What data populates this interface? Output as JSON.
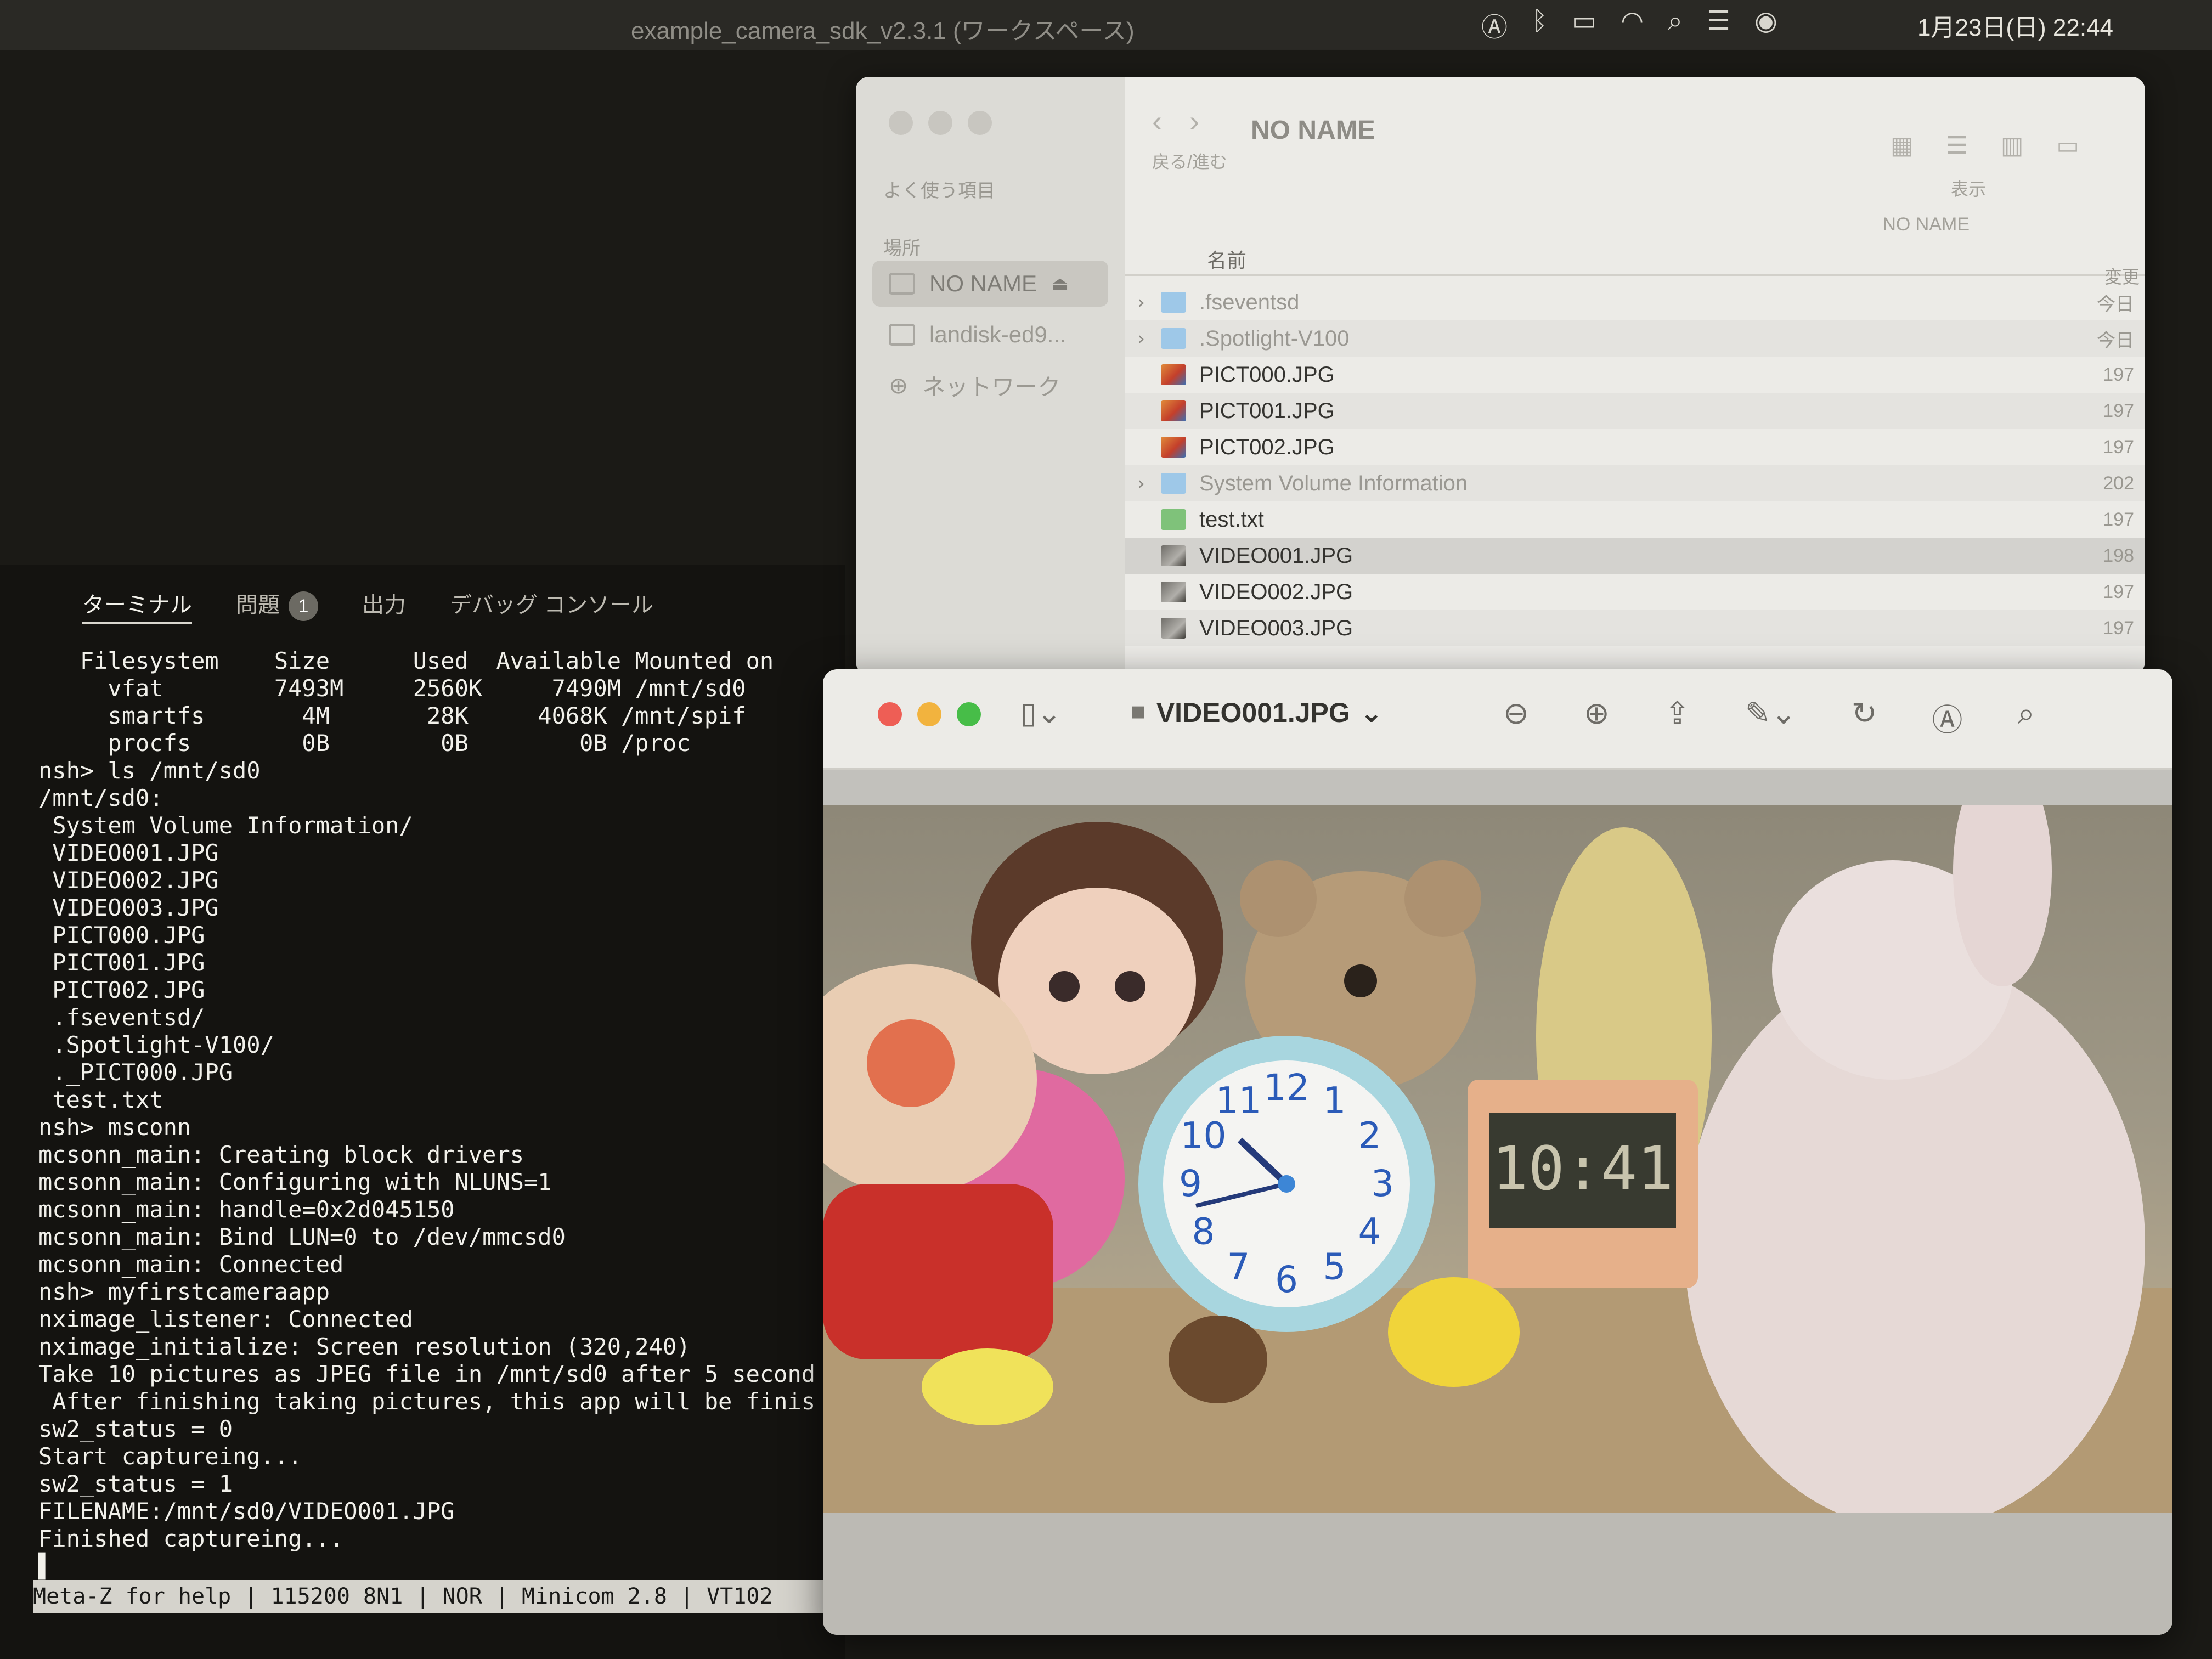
{
  "menubar": {
    "window_title": "example_camera_sdk_v2.3.1 (ワークスペース)",
    "clock": "1月23日(日) 22:44",
    "icons": [
      "input-method-icon",
      "bluetooth-icon",
      "battery-icon",
      "wifi-icon",
      "search-icon",
      "control-center-icon",
      "siri-icon"
    ]
  },
  "terminal": {
    "tabs": [
      {
        "label": "ターミナル",
        "active": true
      },
      {
        "label": "問題",
        "badge": "1"
      },
      {
        "label": "出力"
      },
      {
        "label": "デバッグ コンソール"
      }
    ],
    "lines": [
      "   Filesystem    Size      Used  Available Mounted on",
      "     vfat        7493M     2560K     7490M /mnt/sd0",
      "     smartfs       4M       28K     4068K /mnt/spif",
      "     procfs        0B        0B        0B /proc",
      "nsh> ls /mnt/sd0",
      "/mnt/sd0:",
      " System Volume Information/",
      " VIDEO001.JPG",
      " VIDEO002.JPG",
      " VIDEO003.JPG",
      " PICT000.JPG",
      " PICT001.JPG",
      " PICT002.JPG",
      " .fseventsd/",
      " .Spotlight-V100/",
      " ._PICT000.JPG",
      " test.txt",
      "nsh> msconn",
      "mcsonn_main: Creating block drivers",
      "mcsonn_main: Configuring with NLUNS=1",
      "mcsonn_main: handle=0x2d045150",
      "mcsonn_main: Bind LUN=0 to /dev/mmcsd0",
      "mcsonn_main: Connected",
      "nsh> myfirstcameraapp",
      "nximage_listener: Connected",
      "nximage_initialize: Screen resolution (320,240)",
      "Take 10 pictures as JPEG file in /mnt/sd0 after 5 second",
      " After finishing taking pictures, this app will be finis",
      "sw2_status = 0",
      "Start captureing...",
      "sw2_status = 1",
      "FILENAME:/mnt/sd0/VIDEO001.JPG",
      "Finished captureing...",
      "▌"
    ],
    "status_bar": "Meta-Z for help | 115200 8N1 | NOR | Minicom 2.8 | VT102"
  },
  "finder": {
    "title": "NO NAME",
    "nav_label": "戻る/進む",
    "view_label": "表示",
    "path_label": "NO NAME",
    "favorites_label": "よく使う項目",
    "locations_label": "場所",
    "sidebar_items": [
      {
        "label": "NO NAME",
        "selected": true
      },
      {
        "label": "landisk-ed9..."
      },
      {
        "label": "ネットワーク"
      }
    ],
    "column_name": "名前",
    "column_changed": "変更",
    "files": [
      {
        "name": ".fseventsd",
        "type": "folder",
        "expandable": true,
        "dim": true,
        "date": "今日"
      },
      {
        "name": ".Spotlight-V100",
        "type": "folder",
        "expandable": true,
        "dim": true,
        "date": "今日"
      },
      {
        "name": "PICT000.JPG",
        "type": "jpg",
        "date": "197"
      },
      {
        "name": "PICT001.JPG",
        "type": "jpg",
        "date": "197"
      },
      {
        "name": "PICT002.JPG",
        "type": "jpg",
        "date": "197"
      },
      {
        "name": "System Volume Information",
        "type": "folder",
        "expandable": true,
        "dim": true,
        "date": "202"
      },
      {
        "name": "test.txt",
        "type": "txt",
        "date": "197"
      },
      {
        "name": "VIDEO001.JPG",
        "type": "vjpg",
        "selected": true,
        "date": "198"
      },
      {
        "name": "VIDEO002.JPG",
        "type": "vjpg",
        "date": "197"
      },
      {
        "name": "VIDEO003.JPG",
        "type": "vjpg",
        "date": "197"
      }
    ]
  },
  "preview": {
    "title": "VIDEO001.JPG",
    "toolbar": [
      "sidebar-toggle-icon",
      "zoom-out-icon",
      "zoom-in-icon",
      "share-icon",
      "markup-pen-icon",
      "rotate-icon",
      "annotate-icon",
      "search-icon"
    ],
    "photo": {
      "clock_digits": "10:41",
      "clock_numbers": [
        "12",
        "1",
        "2",
        "3",
        "4",
        "5",
        "6",
        "7",
        "8",
        "9",
        "10",
        "11"
      ]
    }
  }
}
